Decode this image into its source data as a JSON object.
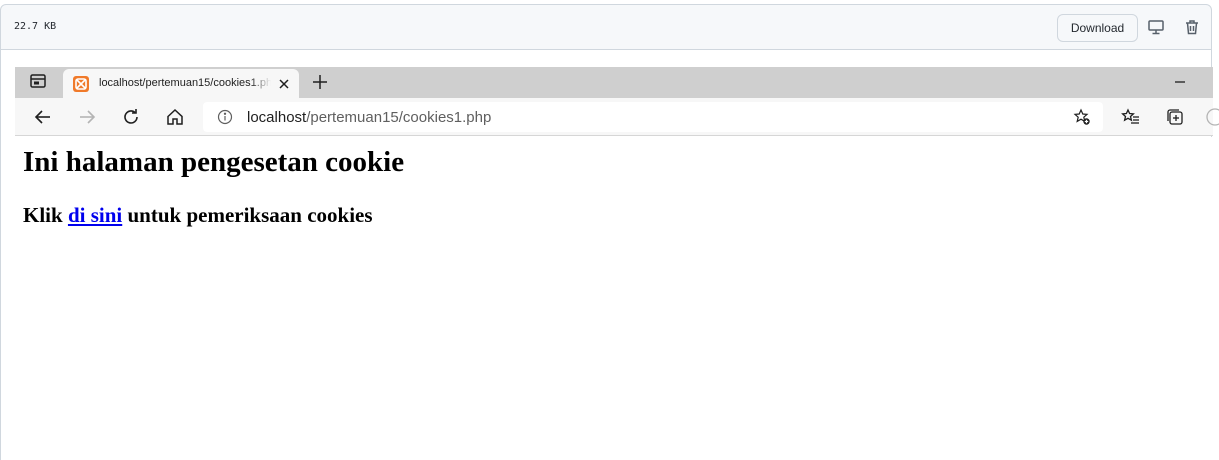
{
  "viewer": {
    "file_size": "22.7 KB",
    "download_label": "Download",
    "icons": [
      "monitor-icon",
      "trash-icon"
    ]
  },
  "browser": {
    "tab": {
      "title": "localhost/pertemuan15/cookies1.php",
      "favicon": "xampp-favicon",
      "favicon_color": "#f07a2a"
    },
    "address": {
      "host": "localhost",
      "path": "/pertemuan15/cookies1.php"
    }
  },
  "page": {
    "heading": "Ini halaman pengesetan cookie",
    "instruction_prefix": "Klik ",
    "link_text": "di sini",
    "instruction_suffix": " untuk pemeriksaan cookies"
  },
  "colors": {
    "link": "#0000ee",
    "tabstrip": "#cfcfcf",
    "toolbar": "#f7f7f7"
  }
}
